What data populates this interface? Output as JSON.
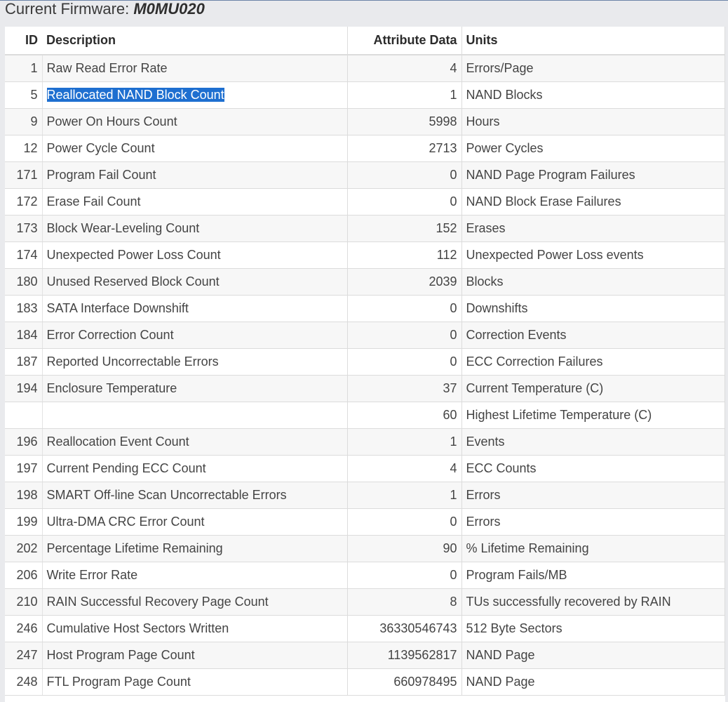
{
  "header": {
    "label": "Current Firmware: ",
    "value": "M0MU020"
  },
  "table": {
    "columns": {
      "id": "ID",
      "description": "Description",
      "data": "Attribute Data",
      "units": "Units"
    },
    "rows": [
      {
        "id": "1",
        "description": "Raw Read Error Rate",
        "data": "4",
        "units": "Errors/Page"
      },
      {
        "id": "5",
        "description": "Reallocated NAND Block Count",
        "data": "1",
        "units": "NAND Blocks",
        "selected": true
      },
      {
        "id": "9",
        "description": "Power On Hours Count",
        "data": "5998",
        "units": "Hours"
      },
      {
        "id": "12",
        "description": "Power Cycle Count",
        "data": "2713",
        "units": "Power Cycles"
      },
      {
        "id": "171",
        "description": "Program Fail Count",
        "data": "0",
        "units": "NAND Page Program Failures"
      },
      {
        "id": "172",
        "description": "Erase Fail Count",
        "data": "0",
        "units": "NAND Block Erase Failures"
      },
      {
        "id": "173",
        "description": "Block Wear-Leveling Count",
        "data": "152",
        "units": "Erases"
      },
      {
        "id": "174",
        "description": "Unexpected Power Loss Count",
        "data": "112",
        "units": "Unexpected Power Loss events"
      },
      {
        "id": "180",
        "description": "Unused Reserved Block Count",
        "data": "2039",
        "units": "Blocks"
      },
      {
        "id": "183",
        "description": "SATA Interface Downshift",
        "data": "0",
        "units": "Downshifts"
      },
      {
        "id": "184",
        "description": "Error Correction Count",
        "data": "0",
        "units": "Correction Events"
      },
      {
        "id": "187",
        "description": "Reported Uncorrectable Errors",
        "data": "0",
        "units": "ECC Correction Failures"
      },
      {
        "id": "194",
        "description": "Enclosure Temperature",
        "data": "37",
        "units": "Current Temperature (C)"
      },
      {
        "id": "",
        "description": "",
        "data": "60",
        "units": "Highest Lifetime Temperature (C)"
      },
      {
        "id": "196",
        "description": "Reallocation Event Count",
        "data": "1",
        "units": "Events"
      },
      {
        "id": "197",
        "description": "Current Pending ECC Count",
        "data": "4",
        "units": "ECC Counts"
      },
      {
        "id": "198",
        "description": "SMART Off-line Scan Uncorrectable Errors",
        "data": "1",
        "units": "Errors"
      },
      {
        "id": "199",
        "description": "Ultra-DMA CRC Error Count",
        "data": "0",
        "units": "Errors"
      },
      {
        "id": "202",
        "description": "Percentage Lifetime Remaining",
        "data": "90",
        "units": "% Lifetime Remaining"
      },
      {
        "id": "206",
        "description": "Write Error Rate",
        "data": "0",
        "units": "Program Fails/MB"
      },
      {
        "id": "210",
        "description": "RAIN Successful Recovery Page Count",
        "data": "8",
        "units": "TUs successfully recovered by RAIN"
      },
      {
        "id": "246",
        "description": "Cumulative Host Sectors Written",
        "data": "36330546743",
        "units": "512 Byte Sectors"
      },
      {
        "id": "247",
        "description": "Host Program Page Count",
        "data": "1139562817",
        "units": "NAND Page"
      },
      {
        "id": "248",
        "description": "FTL Program Page Count",
        "data": "660978495",
        "units": "NAND Page"
      }
    ]
  },
  "colors": {
    "selection": "#1e6fd0",
    "background": "#e9eaed",
    "row_stripe": "#f7f7f7"
  }
}
